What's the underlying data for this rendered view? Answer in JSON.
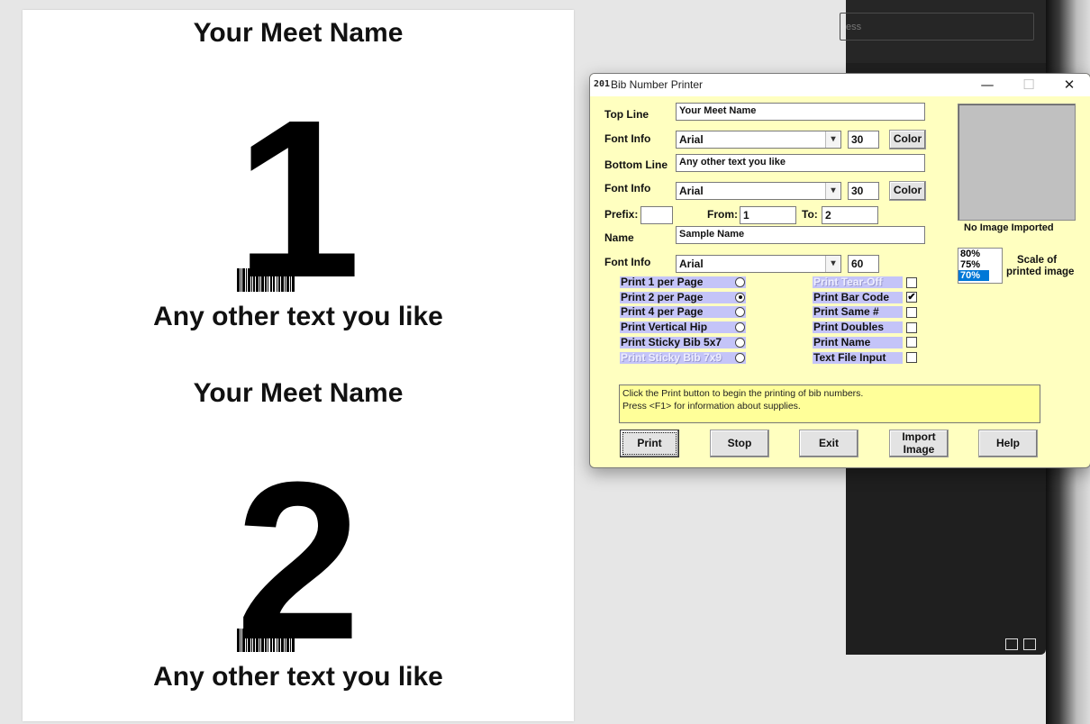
{
  "preview": {
    "bibs": [
      {
        "top_line": "Your Meet Name",
        "number": "1",
        "bottom_line": "Any other text you like"
      },
      {
        "top_line": "Your Meet Name",
        "number": "2",
        "bottom_line": "Any other text you like"
      }
    ]
  },
  "side_panel": {
    "search_placeholder": "ess"
  },
  "window": {
    "app_icon_text": "201",
    "title": "Bib Number Printer",
    "min_glyph": "—",
    "max_glyph": "☐",
    "close_glyph": "✕"
  },
  "form": {
    "top_line_label": "Top Line",
    "top_line_value": "Your Meet Name",
    "font_info_label": "Font Info",
    "top_font": "Arial",
    "top_size": "30",
    "color_label": "Color",
    "bottom_line_label": "Bottom Line",
    "bottom_line_value": "Any other text you like",
    "bottom_font": "Arial",
    "bottom_size": "30",
    "prefix_label": "Prefix:",
    "prefix_value": "",
    "from_label": "From:",
    "from_value": "1",
    "to_label": "To:",
    "to_value": "2",
    "name_label": "Name",
    "name_value": "Sample Name",
    "name_font": "Arial",
    "name_size": "60",
    "dropdown_glyph": "▾"
  },
  "image": {
    "status": "No Image Imported",
    "scale_options": [
      "80%",
      "75%",
      "70%"
    ],
    "scale_selected": "70%",
    "scale_label_1": "Scale of",
    "scale_label_2": "printed image"
  },
  "layout_options": [
    {
      "label": "Print 1 per Page",
      "checked": false,
      "enabled": true
    },
    {
      "label": "Print 2 per Page",
      "checked": true,
      "enabled": true
    },
    {
      "label": "Print 4 per Page",
      "checked": false,
      "enabled": true
    },
    {
      "label": "Print Vertical Hip",
      "checked": false,
      "enabled": true
    },
    {
      "label": "Print Sticky Bib 5x7",
      "checked": false,
      "enabled": true
    },
    {
      "label": "Print Sticky Bib 7x9",
      "checked": false,
      "enabled": false
    }
  ],
  "print_options": [
    {
      "label": "Print Tear-Off",
      "checked": false,
      "enabled": false
    },
    {
      "label": "Print Bar Code",
      "checked": true,
      "enabled": true
    },
    {
      "label": "Print Same #",
      "checked": false,
      "enabled": true
    },
    {
      "label": "Print Doubles",
      "checked": false,
      "enabled": true
    },
    {
      "label": "Print Name",
      "checked": false,
      "enabled": true
    },
    {
      "label": "Text File Input",
      "checked": false,
      "enabled": true
    }
  ],
  "status": {
    "line1": "Click the Print button to begin the printing of bib numbers.",
    "line2": "Press <F1> for information about supplies."
  },
  "buttons": {
    "print": "Print",
    "stop": "Stop",
    "exit": "Exit",
    "import_1": "Import",
    "import_2": "Image",
    "help": "Help"
  },
  "check_glyph": "✔"
}
